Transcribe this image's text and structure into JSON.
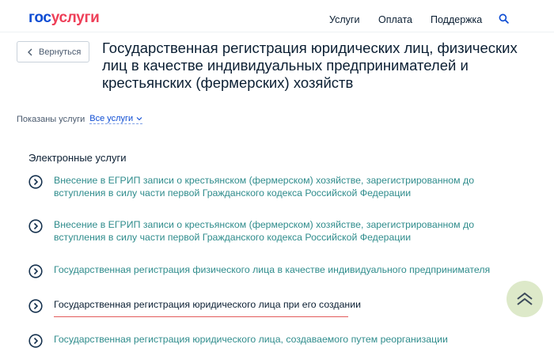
{
  "header": {
    "logo_part1": "гос",
    "logo_part2": "услуги",
    "nav": [
      "Услуги",
      "Оплата",
      "Поддержка"
    ]
  },
  "back_button": {
    "label": "Вернуться"
  },
  "page_title": "Государственная регистрация юридических лиц, физических лиц в качестве индивидуальных предпринимателей и крестьянских (фермерских) хозяйств",
  "filter": {
    "label": "Показаны услуги",
    "selected": "Все услуги"
  },
  "section_title": "Электронные услуги",
  "services": [
    {
      "text": "Внесение в ЕГРИП записи о крестьянском (фермерском) хозяйстве, зарегистрированном до вступления в силу части первой Гражданского кодекса Российской Федерации"
    },
    {
      "text": "Внесение в ЕГРИП записи о крестьянском (фермерском) хозяйстве, зарегистрированном до вступления в силу части первой Гражданского кодекса Российской Федерации"
    },
    {
      "text": "Государственная регистрация физического лица в качестве индивидуального предпринимателя"
    },
    {
      "text": "Государственная регистрация юридического лица при его создании"
    },
    {
      "text": "Государственная регистрация юридического лица, создаваемого путем реорганизации"
    }
  ],
  "colors": {
    "brand_blue": "#0d4cd3",
    "brand_red": "#ee3f58",
    "link_teal": "#2f8c8c",
    "highlight_underline": "#e25b5b",
    "scroll_button_bg": "#dde9c9"
  },
  "icons": {
    "search": "search-icon",
    "back": "chevron-left-icon",
    "dropdown": "chevron-down-icon",
    "service": "circle-arrow-right-icon",
    "scroll_top": "double-chevron-up-icon"
  }
}
